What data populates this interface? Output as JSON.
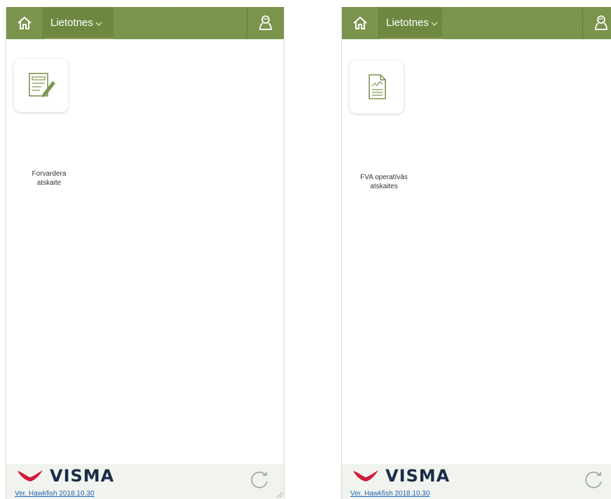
{
  "panels": [
    {
      "nav": {
        "apps_label": "Lietotnes"
      },
      "tile": {
        "label": "Forvardera\natskaite",
        "icon": "report-edit-icon"
      },
      "footer": {
        "brand": "VISMA",
        "version": "Ver. Hawkfish 2018.10.30"
      }
    },
    {
      "nav": {
        "apps_label": "Lietotnes"
      },
      "tile": {
        "label": "FVA operatīvās\natskaites",
        "icon": "chart-document-icon"
      },
      "footer": {
        "brand": "VISMA",
        "version": "Ver. Hawkfish 2018.10.30"
      }
    }
  ],
  "colors": {
    "topbar": "#78924a",
    "icon_green": "#7a9650",
    "brand_red": "#cf1c3d",
    "brand_navy": "#1a2d4a"
  }
}
